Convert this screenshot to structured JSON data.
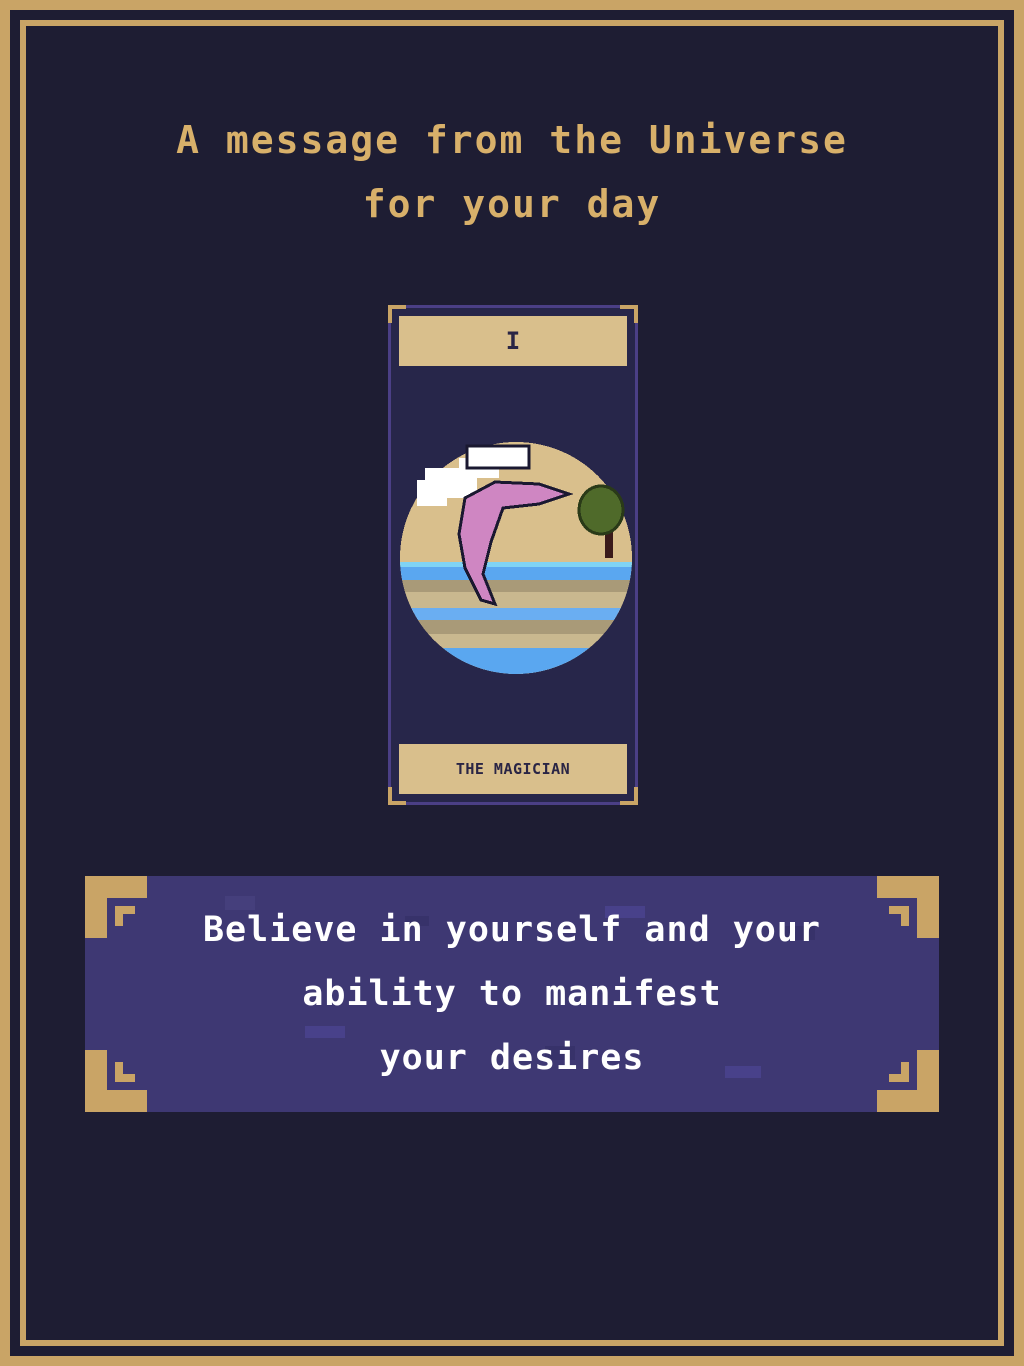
{
  "heading": {
    "line1": "A message from the Universe",
    "line2": "for your day"
  },
  "card": {
    "numeral": "I",
    "name": "THE MAGICIAN",
    "illustration": "dolphin-illustration"
  },
  "message": {
    "line1": "Believe in yourself and your",
    "line2": "ability to manifest",
    "line3": "your desires"
  },
  "colors": {
    "background": "#1e1d33",
    "gold": "#c9a466",
    "heading_text": "#d8b06a",
    "card_label_bg": "#d9bf8c",
    "banner_bg": "#3e3873",
    "banner_text": "#ffffff"
  }
}
